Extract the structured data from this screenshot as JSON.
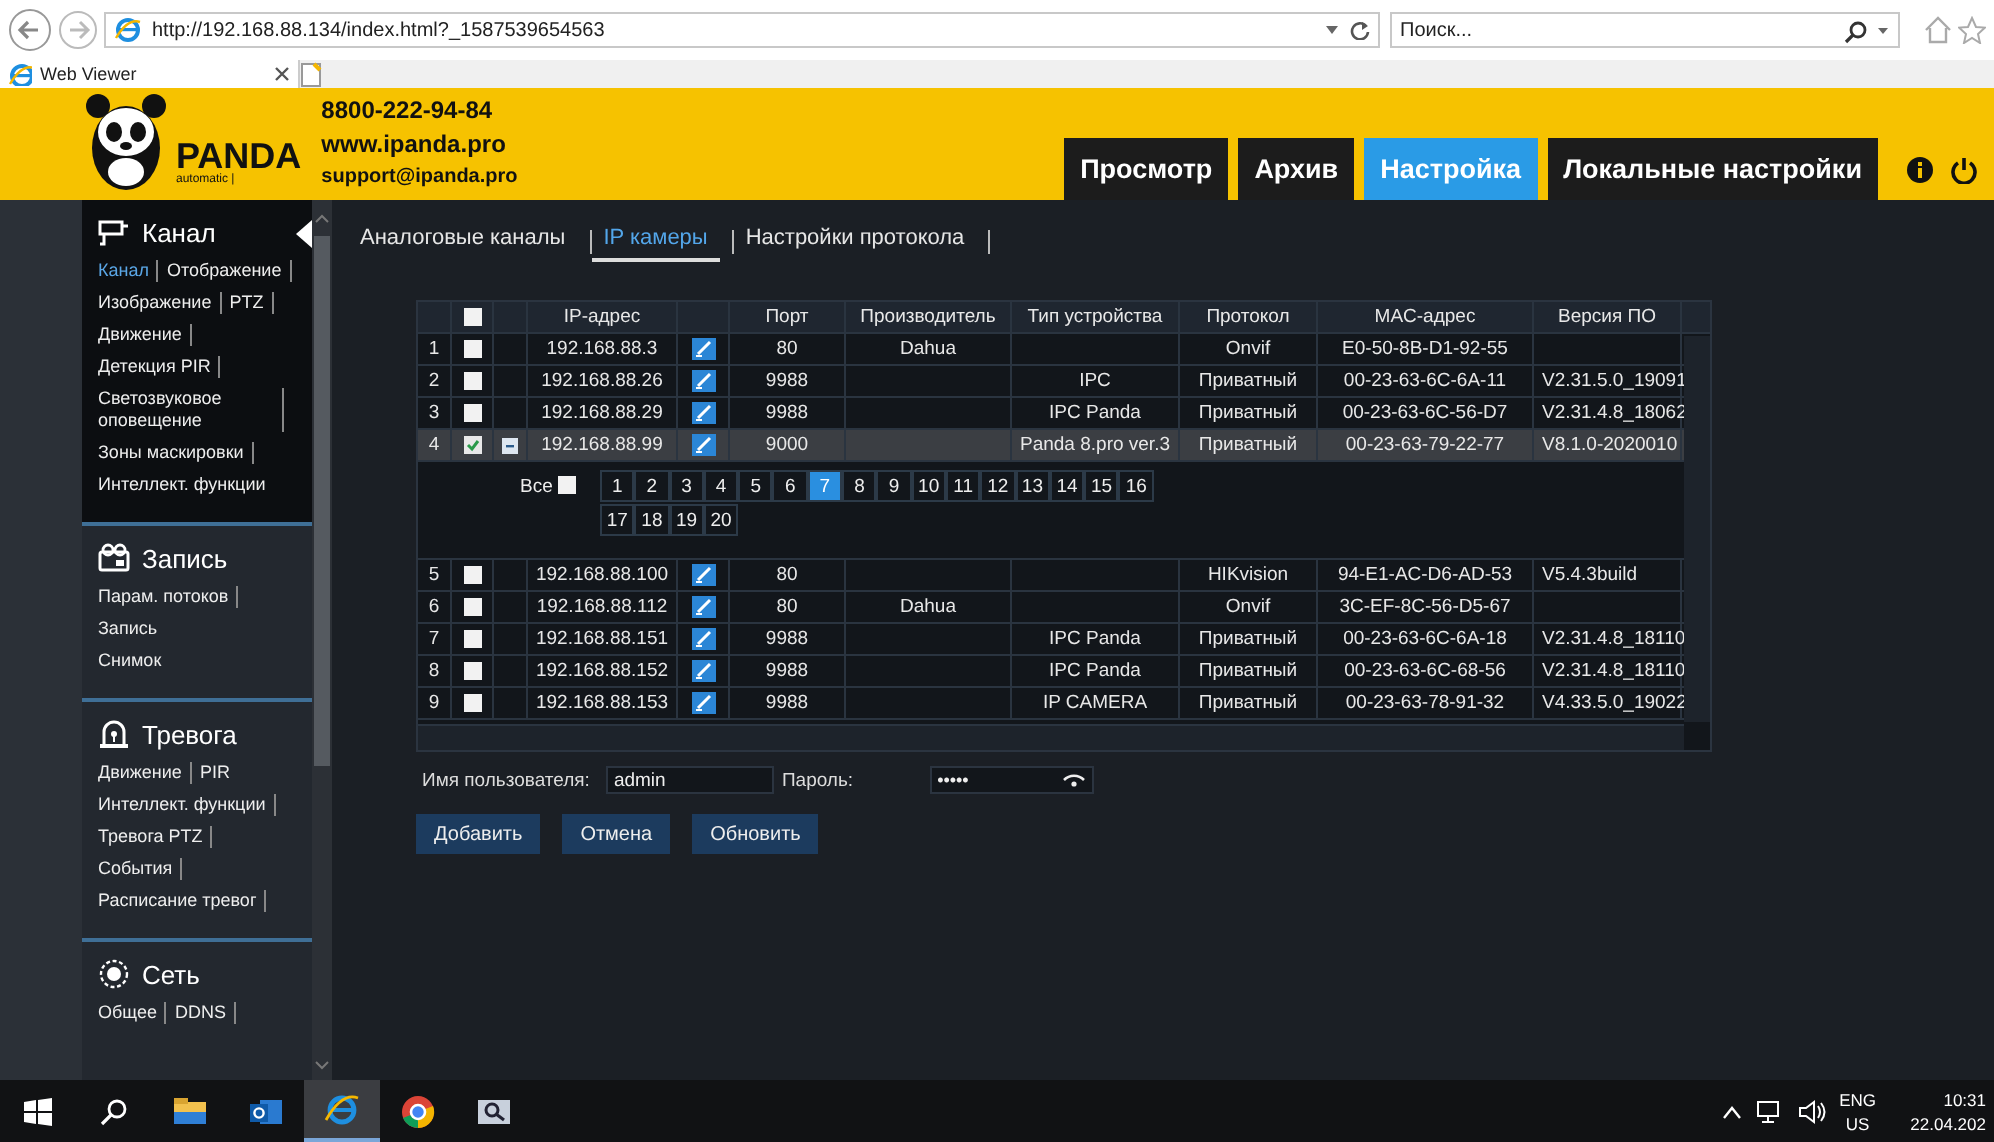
{
  "browser": {
    "address": "http://192.168.88.134/index.html?_1587539654563",
    "search": {
      "placeholder": "Поиск..."
    },
    "tab": {
      "title": "Web Viewer"
    }
  },
  "header": {
    "brand": "PANDA",
    "brand_sub": "automatic |",
    "contacts": [
      "8800-222-94-84",
      "www.ipanda.pro",
      "support@ipanda.pro"
    ],
    "nav": [
      {
        "label": "Просмотр",
        "selected": false
      },
      {
        "label": "Архив",
        "selected": false
      },
      {
        "label": "Настройка",
        "selected": true
      },
      {
        "label": "Локальные настройки",
        "selected": false
      }
    ]
  },
  "sidebar": {
    "sections": [
      {
        "title": "Канал",
        "kind": "camera",
        "active": true,
        "lines": [
          [
            {
              "label": "Канал",
              "selected": true,
              "divider": true
            },
            {
              "label": "Отображение",
              "selected": false,
              "divider": true
            }
          ],
          [
            {
              "label": "Изображение",
              "selected": false,
              "divider": true
            },
            {
              "label": "PTZ",
              "selected": false,
              "divider": true
            }
          ],
          [
            {
              "label": "Движение",
              "selected": false,
              "divider": true
            }
          ],
          [
            {
              "label": "Детекция PIR",
              "selected": false,
              "divider": true
            }
          ],
          [
            {
              "label": "Светозвуковое оповещение",
              "selected": false,
              "divider": true
            }
          ],
          [
            {
              "label": "Зоны маскировки",
              "selected": false,
              "divider": true
            }
          ],
          [
            {
              "label": "Интеллект. функции",
              "selected": false,
              "divider": false
            }
          ]
        ]
      },
      {
        "title": "Запись",
        "kind": "record",
        "active": false,
        "lines": [
          [
            {
              "label": "Парам. потоков",
              "selected": false,
              "divider": true
            }
          ],
          [
            {
              "label": "Запись",
              "selected": false,
              "divider": false
            }
          ],
          [
            {
              "label": "Снимок",
              "selected": false,
              "divider": false
            }
          ]
        ]
      },
      {
        "title": "Тревога",
        "kind": "alarm",
        "active": false,
        "lines": [
          [
            {
              "label": "Движение",
              "selected": false,
              "divider": true
            },
            {
              "label": "PIR",
              "selected": false,
              "divider": false
            }
          ],
          [
            {
              "label": "Интеллект. функции",
              "selected": false,
              "divider": true
            }
          ],
          [
            {
              "label": "Тревога PTZ",
              "selected": false,
              "divider": true
            }
          ],
          [
            {
              "label": "События",
              "selected": false,
              "divider": true
            }
          ],
          [
            {
              "label": "Расписание тревог",
              "selected": false,
              "divider": true
            }
          ]
        ]
      },
      {
        "title": "Сеть",
        "kind": "network",
        "active": false,
        "lines": [
          [
            {
              "label": "Общее",
              "selected": false,
              "divider": true
            },
            {
              "label": "DDNS",
              "selected": false,
              "divider": true
            }
          ]
        ]
      }
    ]
  },
  "content": {
    "tabs": [
      {
        "label": "Аналоговые каналы",
        "selected": false
      },
      {
        "label": "IP камеры",
        "selected": true
      },
      {
        "label": "Настройки протокола",
        "selected": false
      }
    ],
    "table": {
      "all_checked": false,
      "columns": {
        "ip": "IP-адрес",
        "port": "Порт",
        "maker": "Производитель",
        "type": "Тип устройства",
        "protocol": "Протокол",
        "mac": "MAC-адрес",
        "version": "Версия ПО"
      },
      "rows": [
        {
          "index": "1",
          "checked": false,
          "expanded": false,
          "ip": "192.168.88.3",
          "port": "80",
          "maker": "Dahua",
          "protocol": "Onvif",
          "mac": "E0-50-8B-D1-92-55"
        },
        {
          "index": "2",
          "checked": false,
          "expanded": false,
          "ip": "192.168.88.26",
          "port": "9988",
          "type": "IPC",
          "protocol": "Приватный",
          "mac": "00-23-63-6C-6A-11",
          "version": "V2.31.5.0_19091"
        },
        {
          "index": "3",
          "checked": false,
          "expanded": false,
          "ip": "192.168.88.29",
          "port": "9988",
          "type": "IPC Panda",
          "protocol": "Приватный",
          "mac": "00-23-63-6C-56-D7",
          "version": "V2.31.4.8_18062"
        },
        {
          "index": "4",
          "checked": true,
          "expanded": true,
          "ip": "192.168.88.99",
          "port": "9000",
          "type": "Panda 8.pro ver.3",
          "protocol": "Приватный",
          "mac": "00-23-63-79-22-77",
          "version": "V8.1.0-2020010"
        },
        {
          "index": "5",
          "checked": false,
          "expanded": false,
          "ip": "192.168.88.100",
          "port": "80",
          "protocol": "HIKvision",
          "mac": "94-E1-AC-D6-AD-53",
          "version": "V5.4.3build"
        },
        {
          "index": "6",
          "checked": false,
          "expanded": false,
          "ip": "192.168.88.112",
          "port": "80",
          "maker": "Dahua",
          "protocol": "Onvif",
          "mac": "3C-EF-8C-56-D5-67"
        },
        {
          "index": "7",
          "checked": false,
          "expanded": false,
          "ip": "192.168.88.151",
          "port": "9988",
          "type": "IPC Panda",
          "protocol": "Приватный",
          "mac": "00-23-63-6C-6A-18",
          "version": "V2.31.4.8_18110"
        },
        {
          "index": "8",
          "checked": false,
          "expanded": false,
          "ip": "192.168.88.152",
          "port": "9988",
          "type": "IPC Panda",
          "protocol": "Приватный",
          "mac": "00-23-63-6C-68-56",
          "version": "V2.31.4.8_18110"
        },
        {
          "index": "9",
          "checked": false,
          "expanded": false,
          "ip": "192.168.88.153",
          "port": "9988",
          "type": "IP CAMERA",
          "protocol": "Приватный",
          "mac": "00-23-63-78-91-32",
          "version": "V4.33.5.0_19022"
        }
      ],
      "channel_picker": {
        "all_label": "Все",
        "all_checked": false,
        "channels": [
          {
            "label": "1",
            "selected": false
          },
          {
            "label": "2",
            "selected": false
          },
          {
            "label": "3",
            "selected": false
          },
          {
            "label": "4",
            "selected": false
          },
          {
            "label": "5",
            "selected": false
          },
          {
            "label": "6",
            "selected": false
          },
          {
            "label": "7",
            "selected": true
          },
          {
            "label": "8",
            "selected": false
          },
          {
            "label": "9",
            "selected": false
          },
          {
            "label": "10",
            "selected": false
          },
          {
            "label": "11",
            "selected": false
          },
          {
            "label": "12",
            "selected": false
          },
          {
            "label": "13",
            "selected": false
          },
          {
            "label": "14",
            "selected": false
          },
          {
            "label": "15",
            "selected": false
          },
          {
            "label": "16",
            "selected": false
          },
          {
            "label": "17",
            "selected": false
          },
          {
            "label": "18",
            "selected": false
          },
          {
            "label": "19",
            "selected": false
          },
          {
            "label": "20",
            "selected": false
          }
        ]
      }
    },
    "form": {
      "username_label": "Имя пользователя:",
      "username": "admin",
      "password_label": "Пароль:",
      "password_mask": "•••••"
    },
    "buttons": [
      "Добавить",
      "Отмена",
      "Обновить"
    ]
  },
  "taskbar": {
    "apps": [
      {
        "kind": "folder",
        "active": false
      },
      {
        "kind": "mail",
        "active": false
      },
      {
        "kind": "browser",
        "active": true
      },
      {
        "kind": "chrome",
        "active": false
      },
      {
        "kind": "viewer",
        "active": false
      }
    ],
    "lang": "ENG",
    "region": "US",
    "time": "10:31",
    "date": "22.04.202"
  }
}
